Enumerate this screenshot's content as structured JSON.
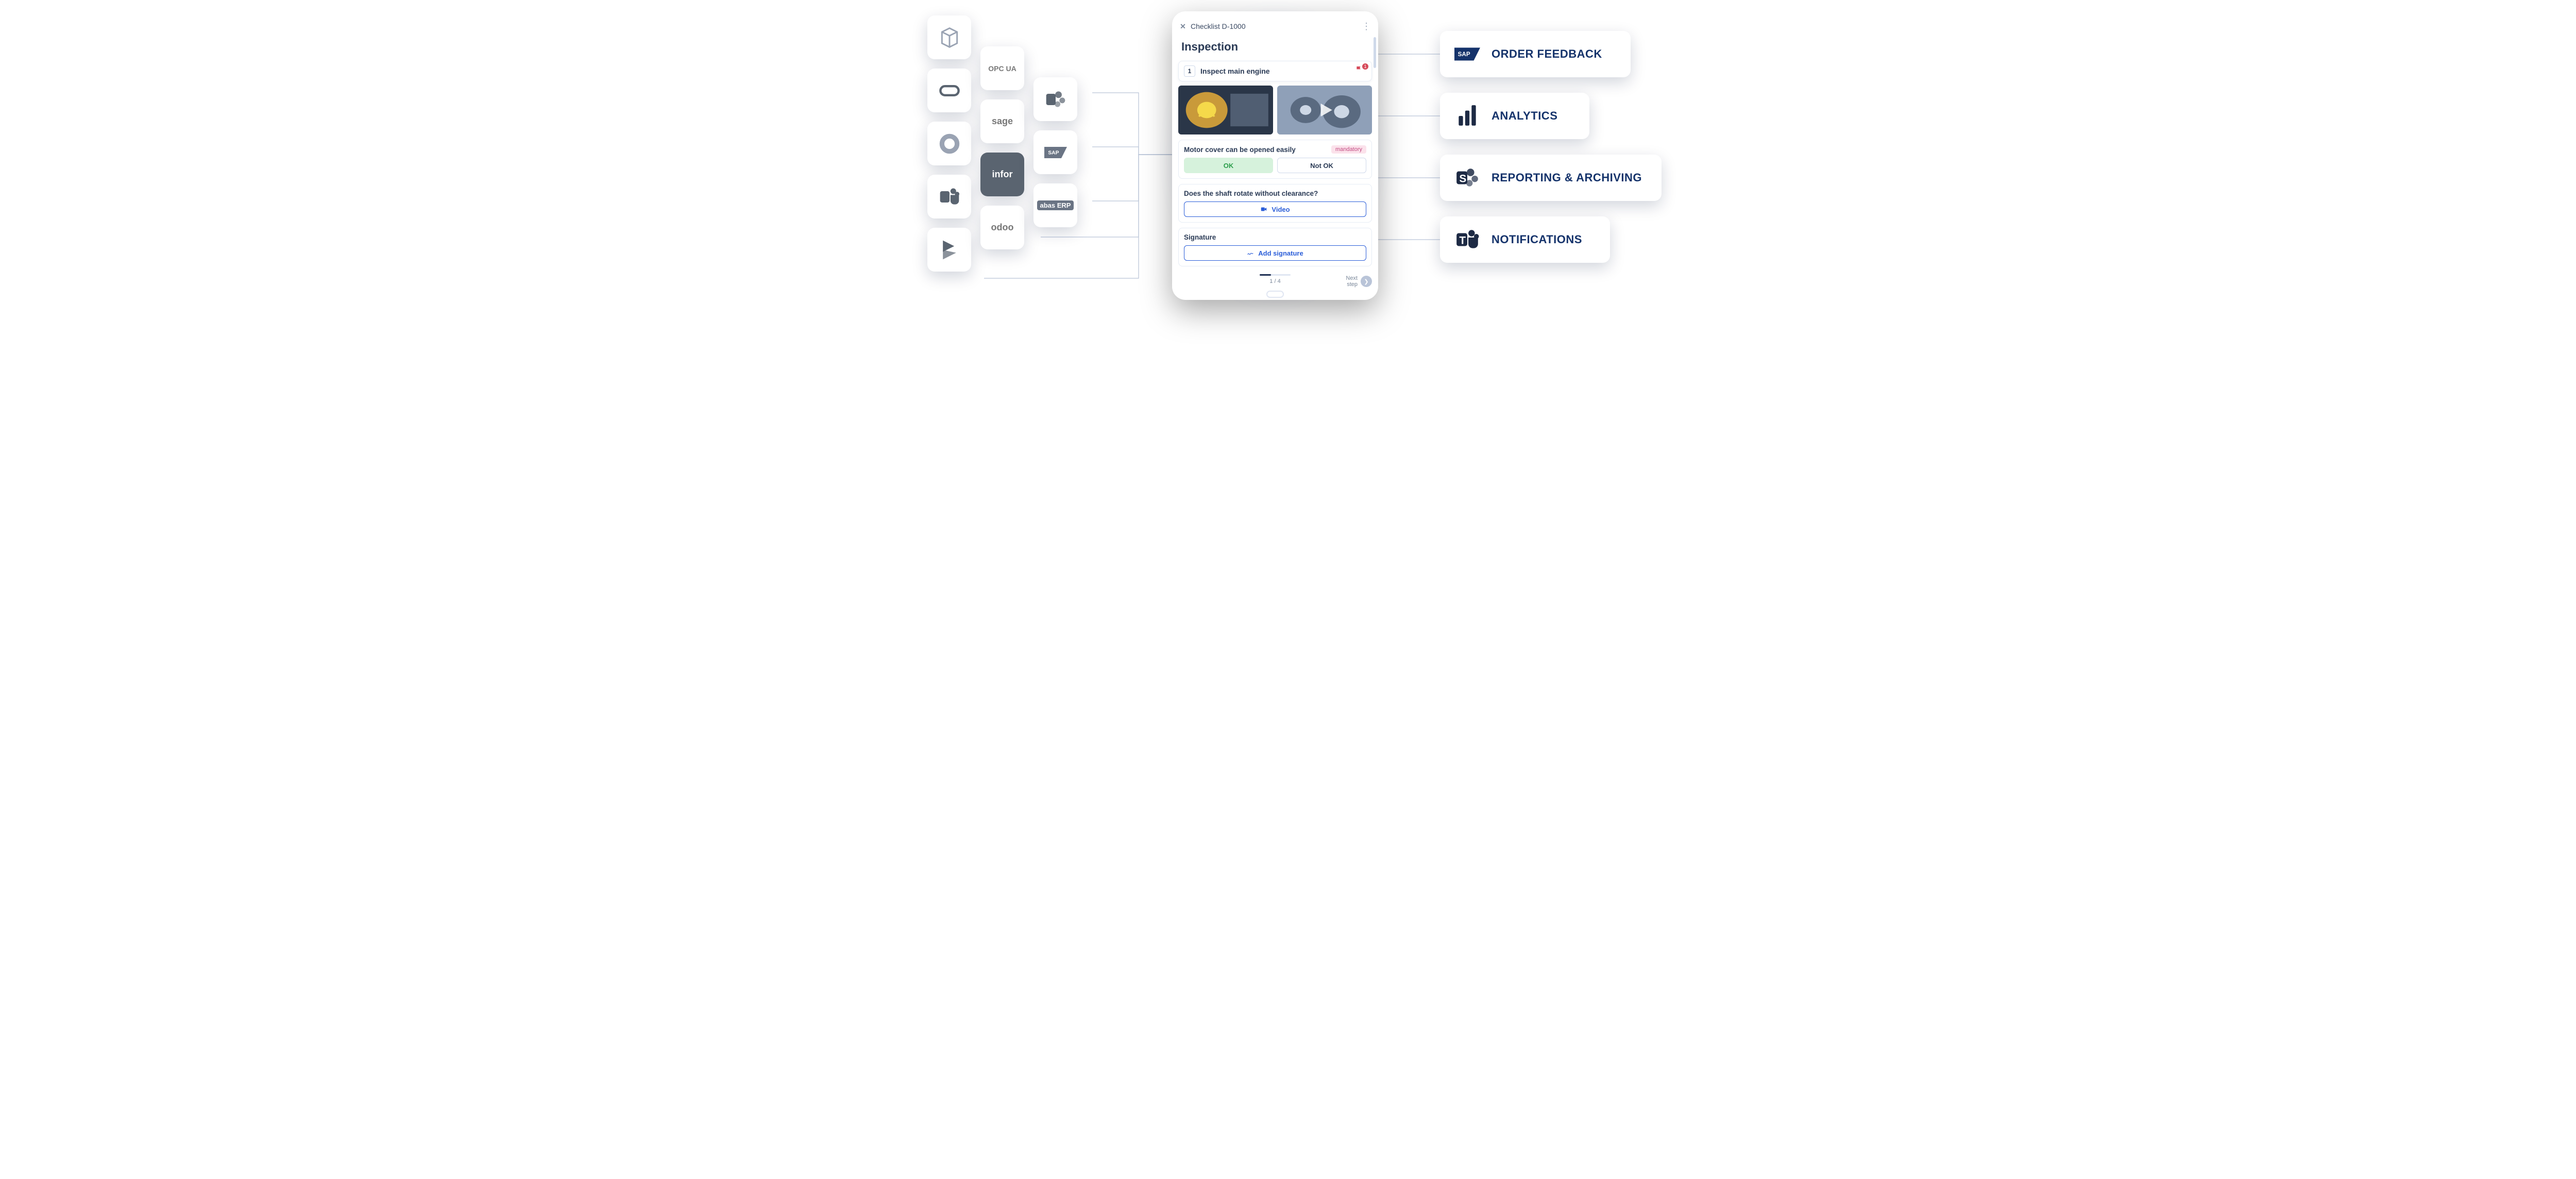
{
  "sources": {
    "col1": [
      {
        "name": "3d-cube-icon"
      },
      {
        "name": "oracle-icon"
      },
      {
        "name": "circle-ring-icon"
      },
      {
        "name": "teams-icon"
      },
      {
        "name": "dynamics-icon"
      }
    ],
    "col2": [
      {
        "name": "opcua-icon",
        "label": "OPC UA"
      },
      {
        "name": "sage-icon",
        "label": "sage"
      },
      {
        "name": "infor-icon",
        "label": "infor"
      },
      {
        "name": "odoo-icon",
        "label": "odoo"
      }
    ],
    "col3": [
      {
        "name": "sharepoint-icon"
      },
      {
        "name": "sap-icon",
        "label": "SAP"
      },
      {
        "name": "abas-icon",
        "label": "abas ERP"
      }
    ]
  },
  "outputs": [
    {
      "icon": "sap-icon",
      "label": "ORDER FEEDBACK"
    },
    {
      "icon": "powerbi-icon",
      "label": "ANALYTICS"
    },
    {
      "icon": "sharepoint-icon",
      "label": "REPORTING & ARCHIVING"
    },
    {
      "icon": "teams-icon",
      "label": "NOTIFICATIONS"
    }
  ],
  "tablet": {
    "header_title": "Checklist D-1000",
    "section_title": "Inspection",
    "step": {
      "number": "1",
      "label": "Inspect main engine",
      "flag_count": "1"
    },
    "q1": {
      "text": "Motor cover can be opened easily",
      "tag": "mandatory",
      "ok": "OK",
      "notok": "Not OK"
    },
    "q2": {
      "text": "Does the shaft rotate without clearance?",
      "video_label": "Video"
    },
    "q3": {
      "text": "Signature",
      "sign_label": "Add signature"
    },
    "pager": {
      "page": "1 / 4",
      "next_label": "Next\nstep"
    }
  }
}
